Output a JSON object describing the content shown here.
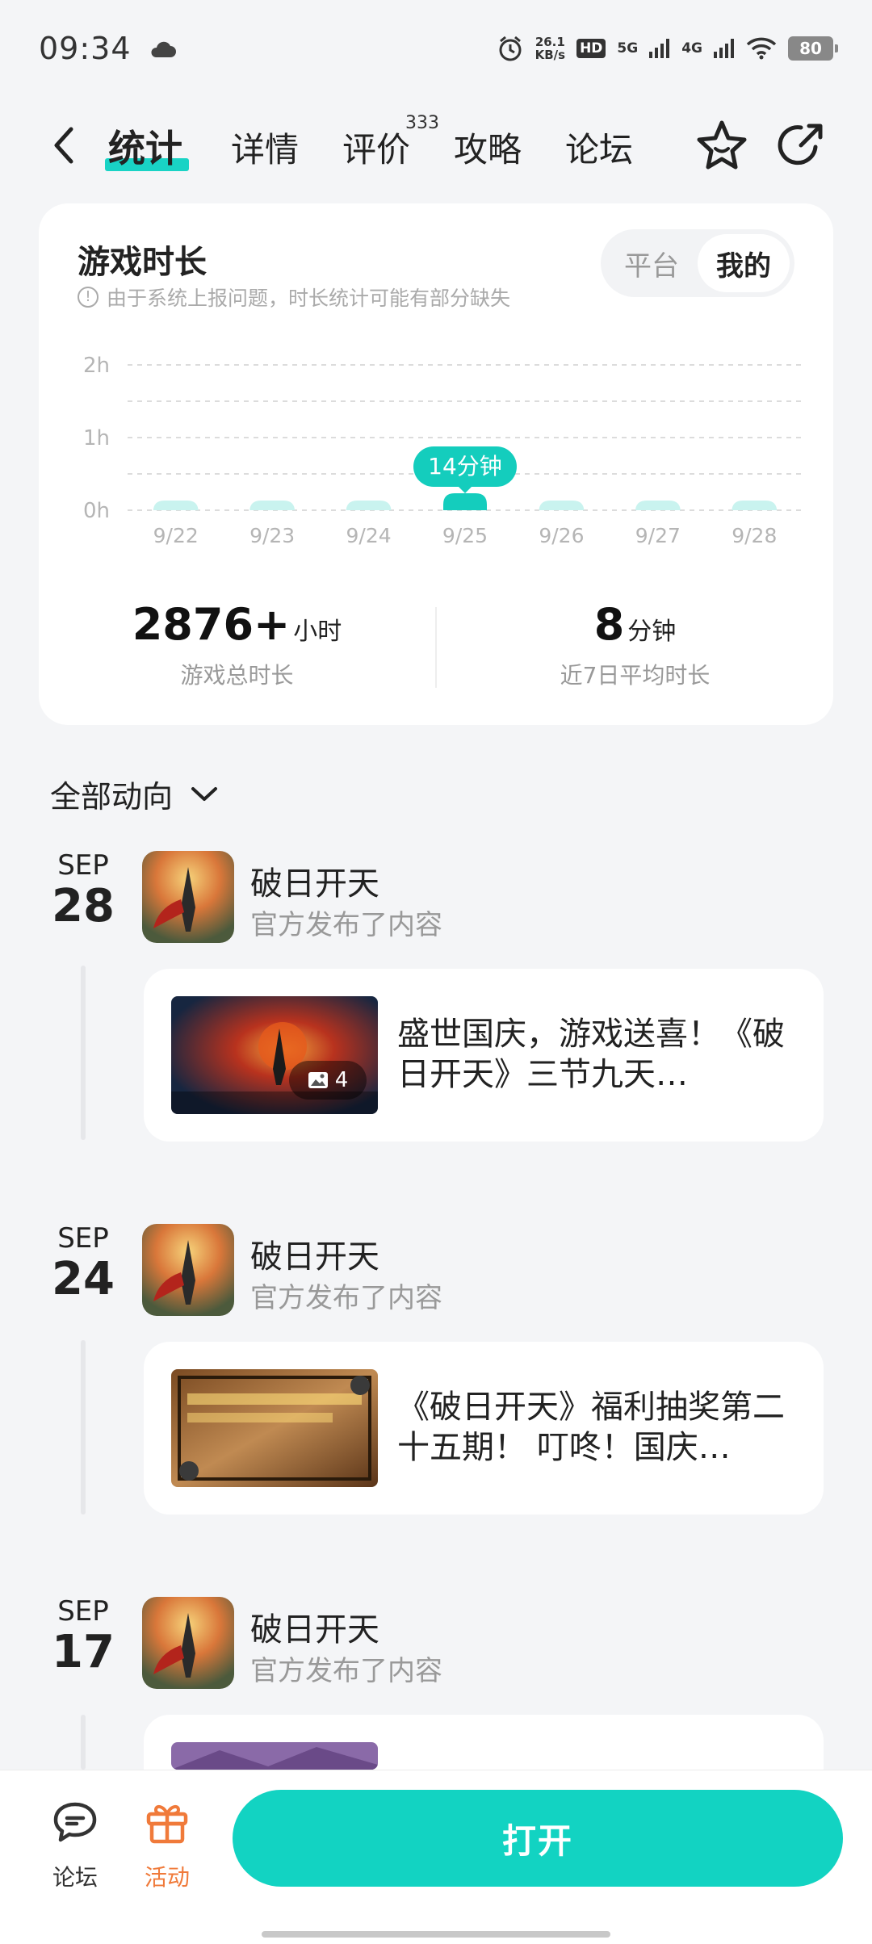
{
  "status": {
    "time": "09:34",
    "net_speed_value": "26.1",
    "net_speed_unit": "KB/s",
    "hd_label": "HD",
    "sig1": "5G",
    "sig2": "4G",
    "battery": "80"
  },
  "nav": {
    "tabs": [
      {
        "label": "统计"
      },
      {
        "label": "详情"
      },
      {
        "label": "评价"
      },
      {
        "label": "攻略"
      },
      {
        "label": "论坛"
      }
    ],
    "review_count": "333"
  },
  "stats": {
    "title": "游戏时长",
    "note": "由于系统上报问题，时长统计可能有部分缺失",
    "toggle": {
      "platform": "平台",
      "mine": "我的",
      "selected": "mine"
    },
    "total_value": "2876+",
    "total_unit": "小时",
    "total_label": "游戏总时长",
    "avg_value": "8",
    "avg_unit": "分钟",
    "avg_label": "近7日平均时长"
  },
  "chart_data": {
    "type": "bar",
    "categories": [
      "9/22",
      "9/23",
      "9/24",
      "9/25",
      "9/26",
      "9/27",
      "9/28"
    ],
    "values": [
      2,
      2,
      2,
      14,
      3,
      5,
      2
    ],
    "value_unit": "minutes",
    "y_ticks": [
      "0h",
      "1h",
      "2h"
    ],
    "ylim": [
      0,
      120
    ],
    "highlight_index": 3,
    "highlight_label": "14分钟",
    "grid": true,
    "colors": {
      "bar": "#c9f3ef",
      "highlight": "#14cdbd"
    }
  },
  "feed": {
    "header": "全部动向",
    "posts": [
      {
        "month": "SEP",
        "day": "28",
        "game": "破日开天",
        "sub": "官方发布了内容",
        "text": "盛世国庆，游戏送喜！《破日开天》三节九天…",
        "img_count": "4"
      },
      {
        "month": "SEP",
        "day": "24",
        "game": "破日开天",
        "sub": "官方发布了内容",
        "text": "《破日开天》福利抽奖第二十五期！ 叮咚！国庆…",
        "img_count": ""
      },
      {
        "month": "SEP",
        "day": "17",
        "game": "破日开天",
        "sub": "官方发布了内容",
        "text": "",
        "img_count": ""
      }
    ]
  },
  "bottom": {
    "forum_label": "论坛",
    "activity_label": "活动",
    "open_label": "打开"
  },
  "colors": {
    "accent": "#12d3c2",
    "activity": "#f07a3a"
  }
}
